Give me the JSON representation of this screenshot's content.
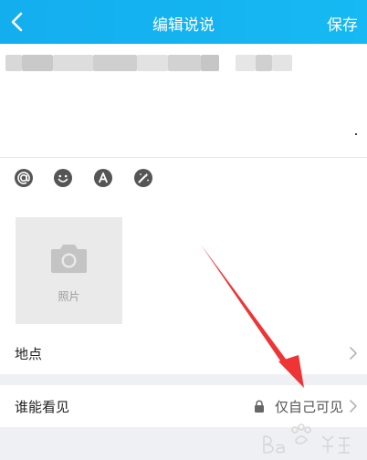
{
  "header": {
    "title": "编辑说说",
    "save_label": "保存",
    "back_icon": "chevron-left-icon"
  },
  "toolbar": {
    "icons": [
      "at-icon",
      "smile-icon",
      "font-icon",
      "magic-wand-icon"
    ]
  },
  "photo": {
    "label": "照片",
    "icon": "camera-icon"
  },
  "rows": {
    "location": {
      "label": "地点"
    },
    "visibility": {
      "label": "谁能看见",
      "value": "仅自己可见"
    }
  },
  "colors": {
    "header": "#13aeee",
    "arrow": "#ee3434"
  }
}
